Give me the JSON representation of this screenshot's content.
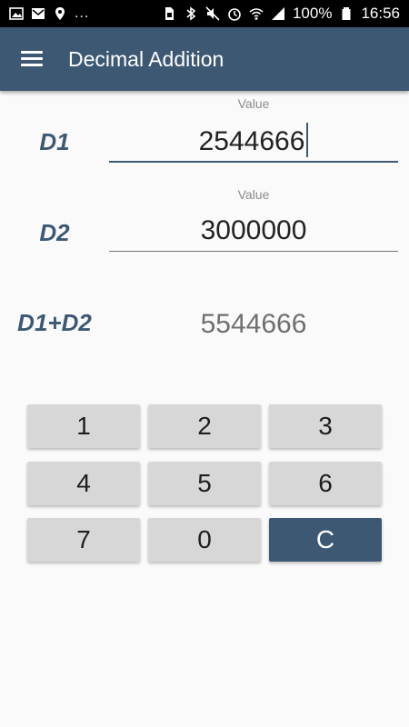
{
  "status_bar": {
    "battery": "100%",
    "time": "16:56",
    "left_icons": [
      "image-icon",
      "mail-icon",
      "location-icon"
    ],
    "overflow": "...",
    "right_icons": [
      "sim-icon",
      "bluetooth-icon",
      "mute-icon",
      "alarm-icon",
      "wifi-icon",
      "signal-icon",
      "battery-icon"
    ]
  },
  "app_bar": {
    "title": "Decimal Addition",
    "menu_icon": "hamburger-menu-icon",
    "color": "#3d5873"
  },
  "d1": {
    "label": "D1",
    "hint": "Value",
    "value": "2544666"
  },
  "d2": {
    "label": "D2",
    "hint": "Value",
    "value": "3000000"
  },
  "sum": {
    "label": "D1+D2",
    "value": "5544666"
  },
  "keypad": {
    "keys": [
      "1",
      "2",
      "3",
      "4",
      "5",
      "6",
      "7",
      "0",
      "C"
    ],
    "key_color": "#d7d7d7",
    "clear_color": "#3d5873"
  }
}
